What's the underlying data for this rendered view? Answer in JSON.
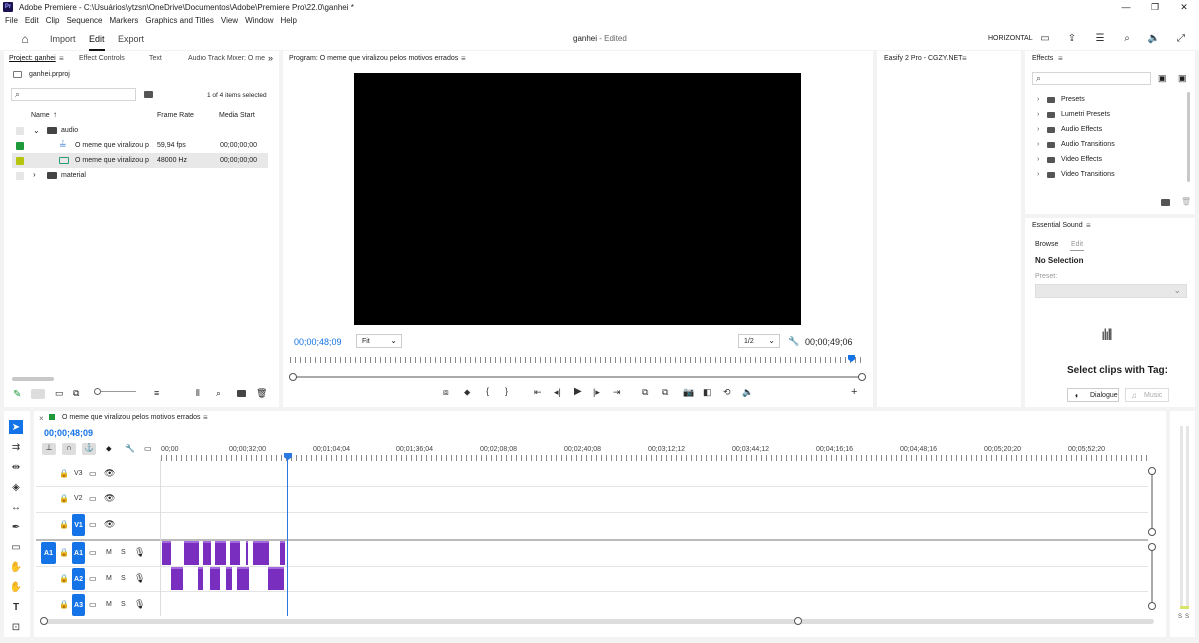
{
  "window": {
    "app_logo": "Pr",
    "title": "Adobe Premiere - C:\\Usuários\\ytzsn\\OneDrive\\Documentos\\Adobe\\Premiere Pro\\22.0\\ganhei *",
    "minimize": "—",
    "maximize": "❐",
    "close": "✕"
  },
  "menu": [
    "File",
    "Edit",
    "Clip",
    "Sequence",
    "Markers",
    "Graphics and Titles",
    "View",
    "Window",
    "Help"
  ],
  "workspace": {
    "tabs": [
      "Import",
      "Edit",
      "Export"
    ],
    "active_tab": "Edit",
    "project_title": "ganhei",
    "project_status": " - Edited",
    "layout_label": "HORIZONTAL"
  },
  "project_panel": {
    "tabs": [
      "Project: ganhei",
      "Effect Controls",
      "Text",
      "Audio Track Mixer: O mer"
    ],
    "file_name": "ganhei.prproj",
    "search_placeholder": "",
    "selection_status": "1 of 4 items selected",
    "columns": [
      "Name",
      "Frame Rate",
      "Media Start"
    ],
    "rows": [
      {
        "name": "audio",
        "frame_rate": "",
        "media_start": "",
        "color": "#e6e6e6"
      },
      {
        "name": "O meme que viralizou p",
        "frame_rate": "59,94 fps",
        "media_start": "00;00;00;00",
        "color": "#1f9a3b"
      },
      {
        "name": "O meme que viralizou p",
        "frame_rate": "48000 Hz",
        "media_start": "00;00;00;00",
        "color": "#b5c40f"
      },
      {
        "name": "material",
        "frame_rate": "",
        "media_start": "",
        "color": "#e6e6e6"
      }
    ]
  },
  "program_monitor": {
    "title": "Program: O meme que viralizou pelos motivos errados",
    "current_time": "00;00;48;09",
    "zoom": "Fit",
    "resolution": "1/2",
    "duration": "00;00;49;06"
  },
  "easify_panel": {
    "title": "Easify 2 Pro - CGZY.NET"
  },
  "effects_panel": {
    "title": "Effects",
    "items": [
      "Presets",
      "Lumetri Presets",
      "Audio Effects",
      "Audio Transitions",
      "Video Effects",
      "Video Transitions"
    ]
  },
  "essential_sound": {
    "title": "Essential Sound",
    "tabs": [
      "Browse",
      "Edit"
    ],
    "no_selection": "No Selection",
    "preset_label": "Preset:",
    "select_clips_text": "Select clips with Tag:",
    "tag_buttons": [
      "Dialogue",
      "Music"
    ]
  },
  "timeline": {
    "sequence_name": "O meme que viralizou pelos motivos errados",
    "current_time": "00;00;48;09",
    "timecodes": [
      "00;00",
      "00;00;32;00",
      "00;01;04;04",
      "00;01;36;04",
      "00;02;08;08",
      "00;02;40;08",
      "00;03;12;12",
      "00;03;44;12",
      "00;04;16;16",
      "00;04;48;16",
      "00;05;20;20",
      "00;05;52;20"
    ],
    "video_tracks": [
      "V3",
      "V2",
      "V1"
    ],
    "audio_tracks": [
      "A1",
      "A2",
      "A3"
    ],
    "source_patch_video": "V1",
    "source_patch_audio": "A1",
    "track_toggles": [
      "M",
      "S"
    ],
    "meter_labels": [
      "S",
      "S"
    ]
  },
  "colors": {
    "accent_blue": "#1473e6",
    "audio_clip": "#7a2ec0",
    "playhead": "#2a78e0"
  }
}
